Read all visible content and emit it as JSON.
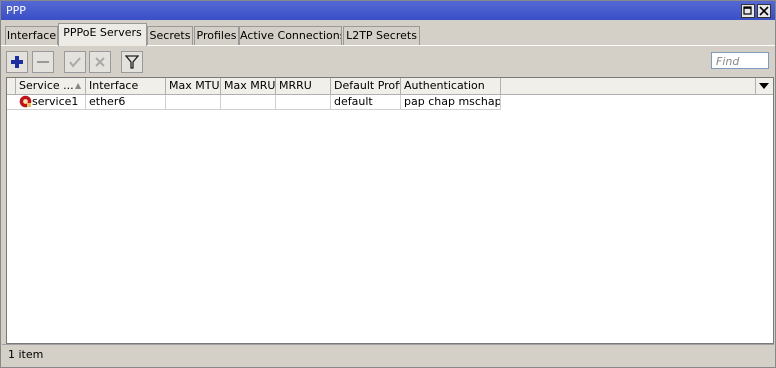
{
  "window": {
    "title": "PPP"
  },
  "tabs": [
    {
      "label": "Interface"
    },
    {
      "label": "PPPoE Servers",
      "active": true
    },
    {
      "label": "Secrets"
    },
    {
      "label": "Profiles"
    },
    {
      "label": "Active Connections"
    },
    {
      "label": "L2TP Secrets"
    }
  ],
  "toolbar": {
    "icons": [
      "add-icon",
      "remove-icon",
      "enable-icon",
      "disable-icon",
      "filter-icon"
    ],
    "find_placeholder": "Find"
  },
  "table": {
    "columns": [
      "Service ...",
      "Interface",
      "Max MTU",
      "Max MRU",
      "MRRU",
      "Default Profile",
      "Authentication"
    ],
    "sort_indicator": "▲",
    "rows": [
      {
        "service": "service1",
        "interface": "ether6",
        "max_mtu": "",
        "max_mru": "",
        "mrru": "",
        "default_profile": "default",
        "authentication": "pap chap mschap..."
      }
    ]
  },
  "status": {
    "text": "1 item"
  },
  "colors": {
    "titlebar": "#3a4fc6",
    "add_icon": "#1d2f9e",
    "service_icon": "#c0141b"
  }
}
